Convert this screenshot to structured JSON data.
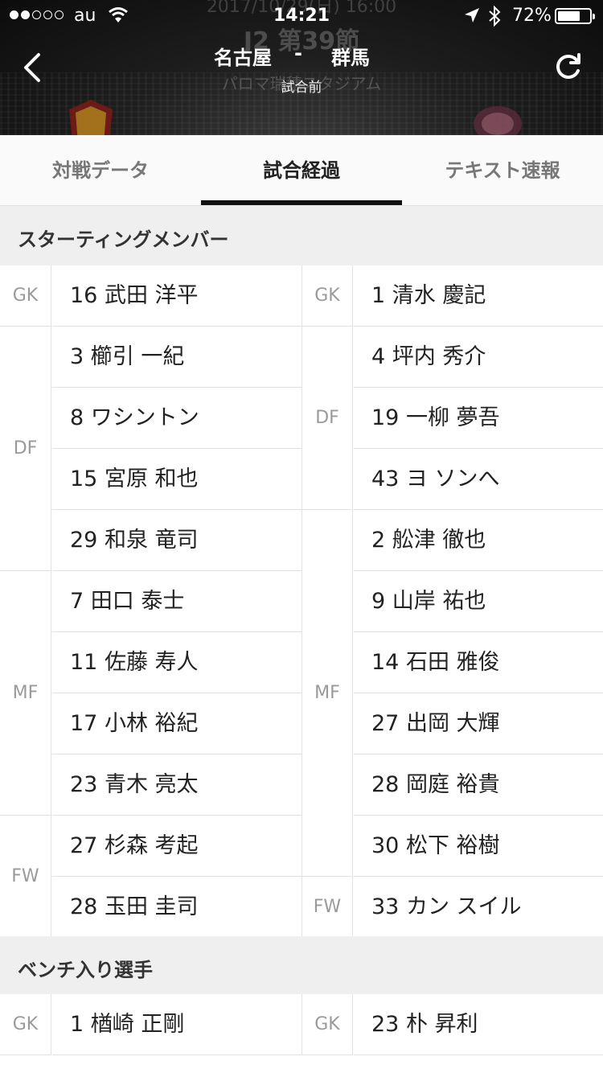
{
  "status_bar": {
    "carrier": "au",
    "time": "14:21",
    "battery": "72%",
    "battery_level": 0.72
  },
  "header": {
    "date_text": "2017/10/29(日) 16:00",
    "round": "J2 第39節",
    "home_team": "名古屋",
    "separator": "-",
    "away_team": "群馬",
    "status": "試合前",
    "venue": "パロマ瑞穂スタジアム"
  },
  "tabs": [
    {
      "label": "対戦データ",
      "active": false
    },
    {
      "label": "試合経過",
      "active": true
    },
    {
      "label": "テキスト速報",
      "active": false
    }
  ],
  "starting": {
    "title": "スターティングメンバー",
    "home": {
      "groups": [
        {
          "pos": "GK",
          "players": [
            "16 武田 洋平"
          ]
        },
        {
          "pos": "DF",
          "players": [
            "3 櫛引 一紀",
            "8 ワシントン",
            "15 宮原 和也",
            "29 和泉 竜司"
          ]
        },
        {
          "pos": "MF",
          "players": [
            "7 田口 泰士",
            "11 佐藤 寿人",
            "17 小林 裕紀",
            "23 青木 亮太"
          ]
        },
        {
          "pos": "FW",
          "players": [
            "27 杉森 考起",
            "28 玉田 圭司"
          ]
        }
      ]
    },
    "away": {
      "groups": [
        {
          "pos": "GK",
          "players": [
            "1 清水 慶記"
          ]
        },
        {
          "pos": "DF",
          "players": [
            "4 坪内 秀介",
            "19 一柳 夢吾",
            "43 ヨ ソンへ"
          ]
        },
        {
          "pos": "MF",
          "players": [
            "2 舩津 徹也",
            "9 山岸 祐也",
            "14 石田 雅俊",
            "27 出岡 大輝",
            "28 岡庭 裕貴",
            "30 松下 裕樹"
          ]
        },
        {
          "pos": "FW",
          "players": [
            "33 カン スイル"
          ]
        }
      ]
    }
  },
  "bench": {
    "title": "ベンチ入り選手",
    "home": {
      "groups": [
        {
          "pos": "GK",
          "players": [
            "1 楢崎 正剛"
          ]
        }
      ]
    },
    "away": {
      "groups": [
        {
          "pos": "GK",
          "players": [
            "23 朴 昇利"
          ]
        }
      ]
    }
  }
}
